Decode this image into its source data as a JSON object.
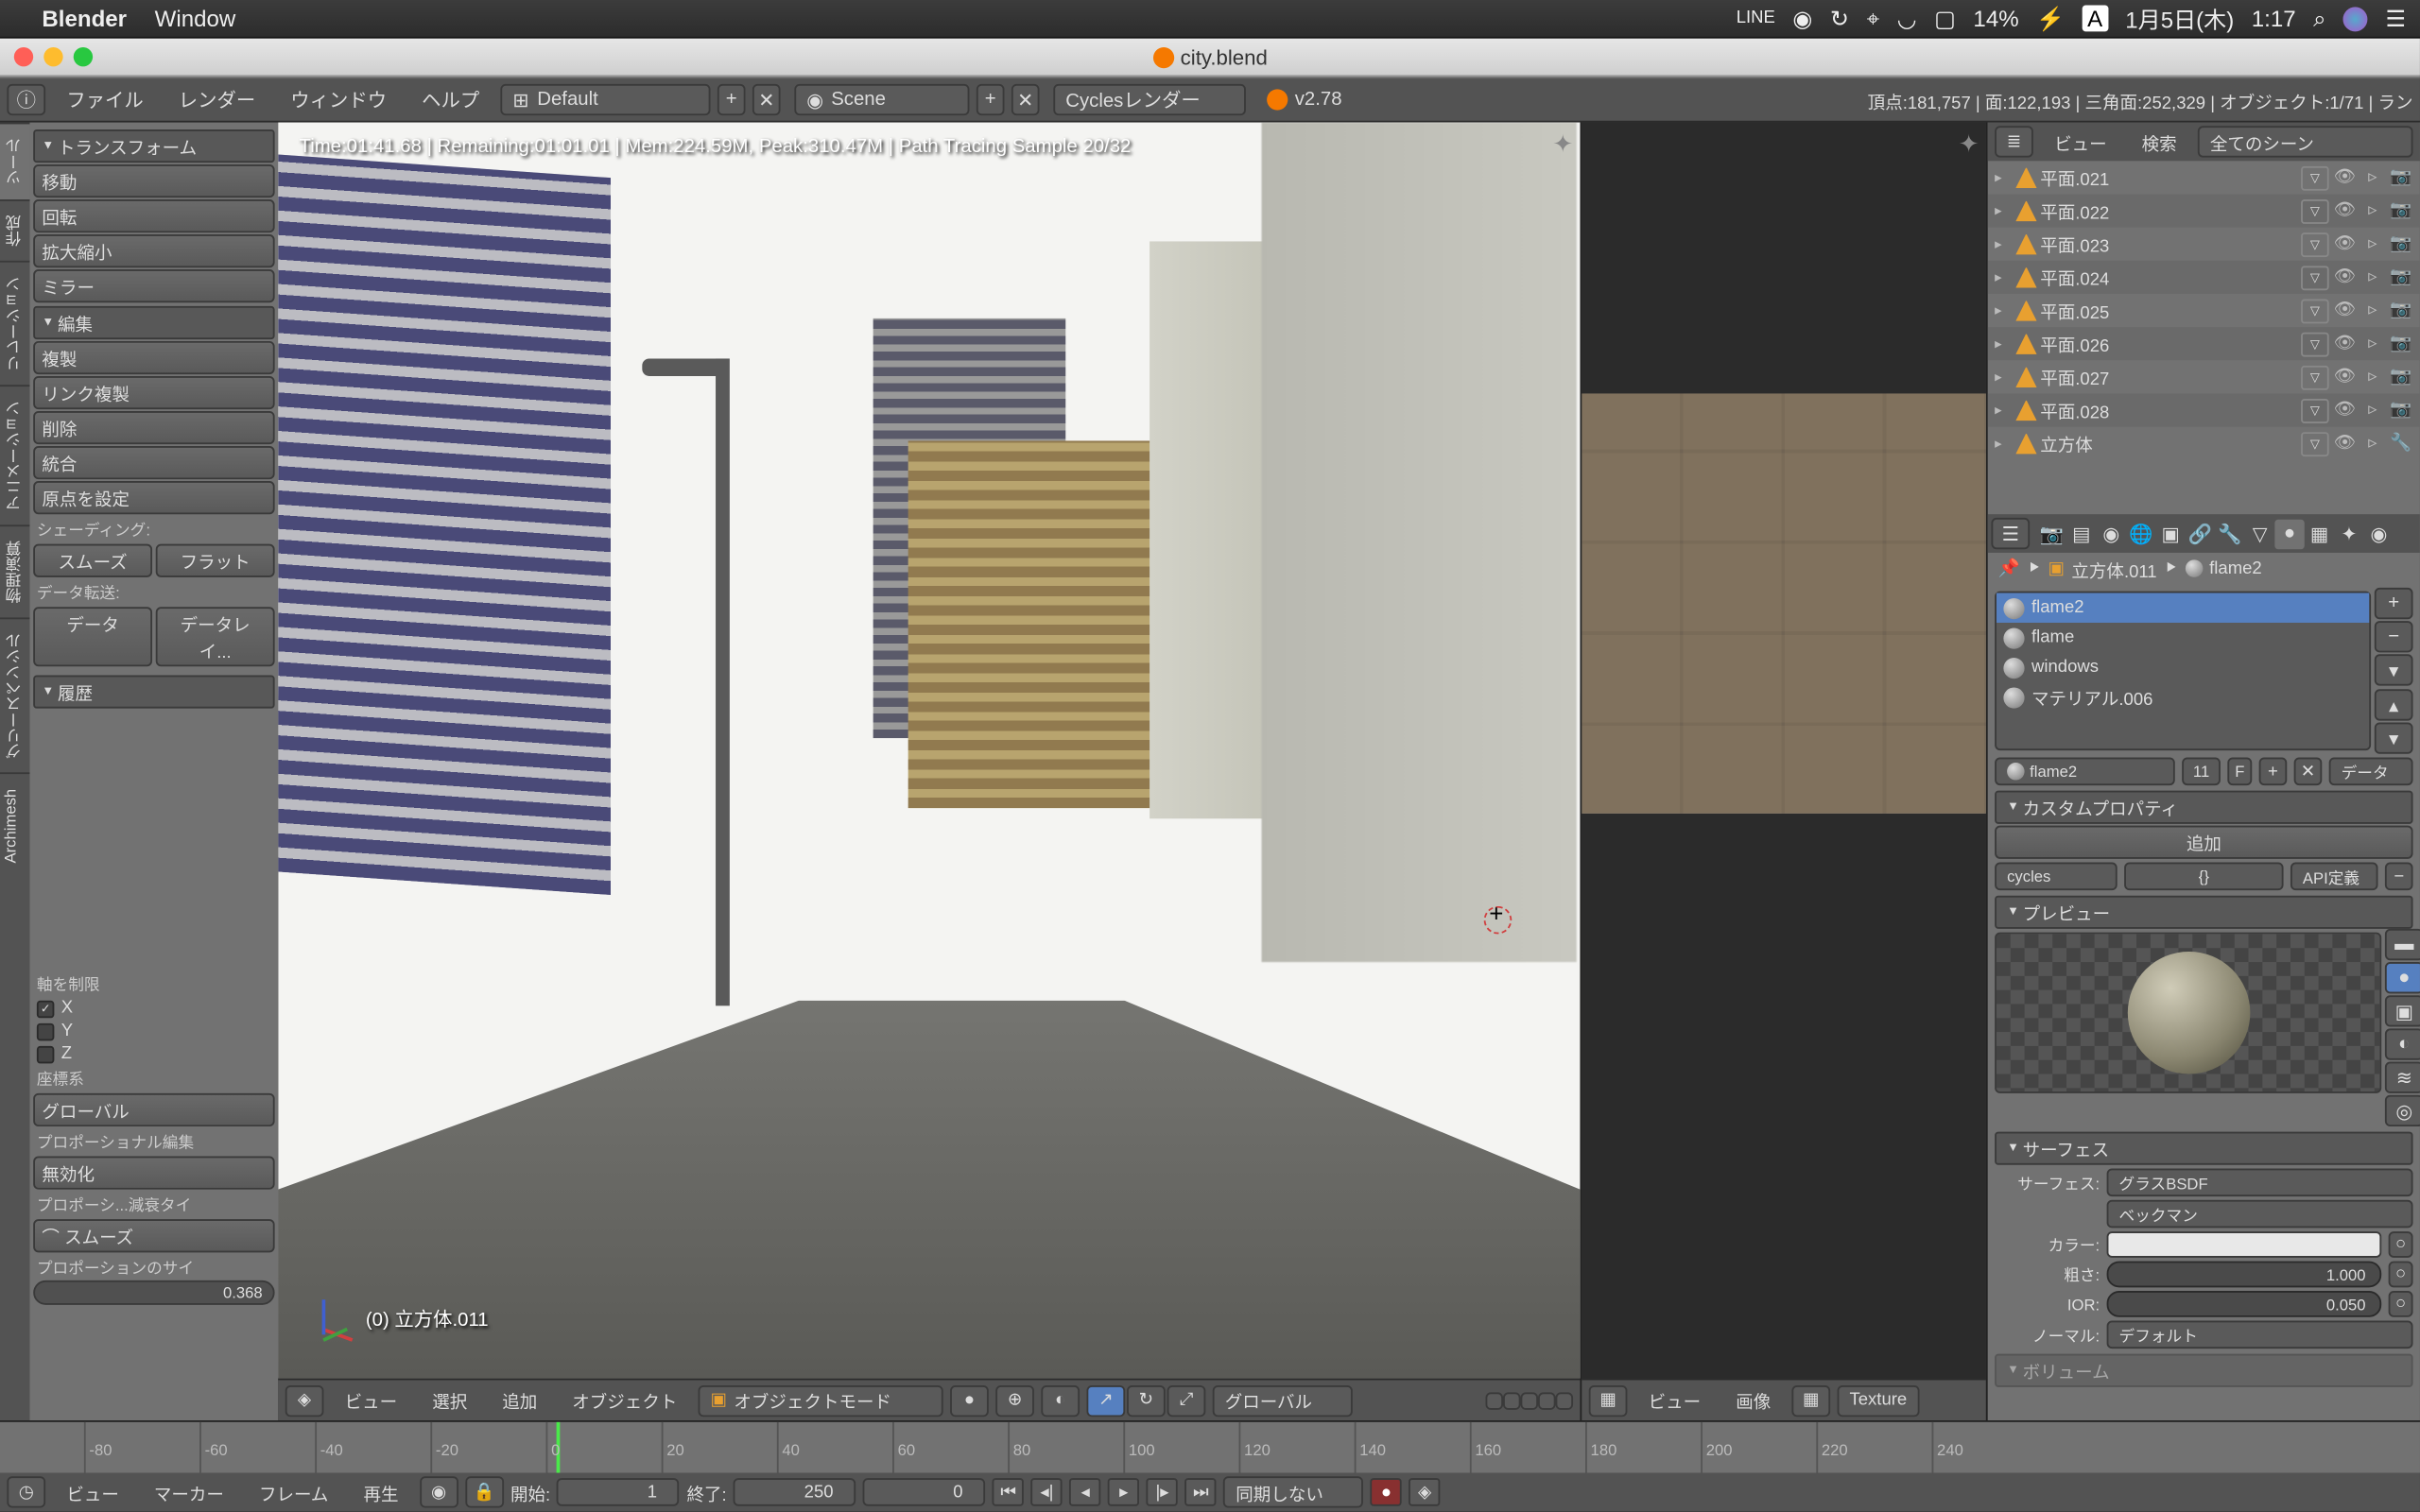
{
  "menubar": {
    "app_name": "Blender",
    "menu_window": "Window",
    "line": "LINE",
    "battery": "14%",
    "input_mode": "A",
    "date": "1月5日(木)",
    "time": "1:17"
  },
  "titlebar": {
    "filename": "city.blend"
  },
  "info_header": {
    "menu_file": "ファイル",
    "menu_render": "レンダー",
    "menu_window": "ウィンドウ",
    "menu_help": "ヘルプ",
    "layout": "Default",
    "scene": "Scene",
    "engine": "Cyclesレンダー",
    "version": "v2.78",
    "stats": "頂点:181,757 | 面:122,193 | 三角面:252,329 | オブジェクト:1/71 | ラン"
  },
  "toolshelf": {
    "tabs": [
      "ツール",
      "作成",
      "リレーション",
      "アニメーション",
      "物理演算",
      "グリースペンシル",
      "Archimesh"
    ],
    "transform_head": "トランスフォーム",
    "move": "移動",
    "rotate": "回転",
    "scale": "拡大縮小",
    "mirror": "ミラー",
    "edit_head": "編集",
    "duplicate": "複製",
    "link_dup": "リンク複製",
    "delete": "削除",
    "join": "統合",
    "set_origin": "原点を設定",
    "shading_label": "シェーディング:",
    "smooth": "スムーズ",
    "flat": "フラット",
    "data_trans_label": "データ転送:",
    "data": "データ",
    "data_lay": "データレイ...",
    "history_head": "履歴",
    "constrain_label": "軸を制限",
    "axis_x": "X",
    "axis_y": "Y",
    "axis_z": "Z",
    "coord_label": "座標系",
    "coord_val": "グローバル",
    "prop_edit_label": "プロポーショナル編集",
    "prop_edit_val": "無効化",
    "falloff_label": "プロポーシ...減衰タイ",
    "falloff_val": "スムーズ",
    "prop_size_label": "プロポーションのサイ",
    "prop_size_val": "0.368"
  },
  "viewport": {
    "render_stats": "Time:01:41.68 | Remaining:01:01.01 | Mem:224.59M, Peak:310.47M | Path Tracing Sample 20/32",
    "object_label": "(0) 立方体.011",
    "view": "ビュー",
    "select": "選択",
    "add": "追加",
    "object": "オブジェクト",
    "mode": "オブジェクトモード",
    "orientation": "グローバル"
  },
  "uv_editor": {
    "view": "ビュー",
    "image": "画像",
    "mode": "Texture"
  },
  "outliner": {
    "view": "ビュー",
    "search": "検索",
    "all_scenes": "全てのシーン",
    "items": [
      {
        "name": "平面.021"
      },
      {
        "name": "平面.022"
      },
      {
        "name": "平面.023"
      },
      {
        "name": "平面.024"
      },
      {
        "name": "平面.025"
      },
      {
        "name": "平面.026"
      },
      {
        "name": "平面.027"
      },
      {
        "name": "平面.028"
      },
      {
        "name": "立方体"
      }
    ]
  },
  "properties": {
    "breadcrumb_obj": "立方体.011",
    "breadcrumb_mat": "flame2",
    "materials": [
      {
        "name": "flame2",
        "sel": true
      },
      {
        "name": "flame",
        "sel": false
      },
      {
        "name": "windows",
        "sel": false
      },
      {
        "name": "マテリアル.006",
        "sel": false
      }
    ],
    "mat_datablock": "flame2",
    "mat_users": "11",
    "mat_f": "F",
    "mat_link": "データ",
    "custom_head": "カスタムプロパティ",
    "add_btn": "追加",
    "cycles_key": "cycles",
    "cycles_val": "{}",
    "api_def": "API定義",
    "preview_head": "プレビュー",
    "surface_head": "サーフェス",
    "surface_lbl": "サーフェス:",
    "surface_val": "グラスBSDF",
    "dist_val": "ベックマン",
    "color_lbl": "カラー:",
    "rough_lbl": "粗さ:",
    "rough_val": "1.000",
    "ior_lbl": "IOR:",
    "ior_val": "0.050",
    "normal_lbl": "ノーマル:",
    "normal_val": "デフォルト",
    "volume_head": "ボリューム"
  },
  "timeline": {
    "ticks": [
      "-80",
      "-60",
      "-40",
      "-20",
      "0",
      "20",
      "40",
      "60",
      "80",
      "100",
      "120",
      "140",
      "160",
      "180",
      "200",
      "220",
      "240"
    ],
    "view": "ビュー",
    "marker": "マーカー",
    "frame": "フレーム",
    "playback": "再生",
    "start_lbl": "開始:",
    "start_val": "1",
    "end_lbl": "終了:",
    "end_val": "250",
    "sync": "同期しない"
  }
}
